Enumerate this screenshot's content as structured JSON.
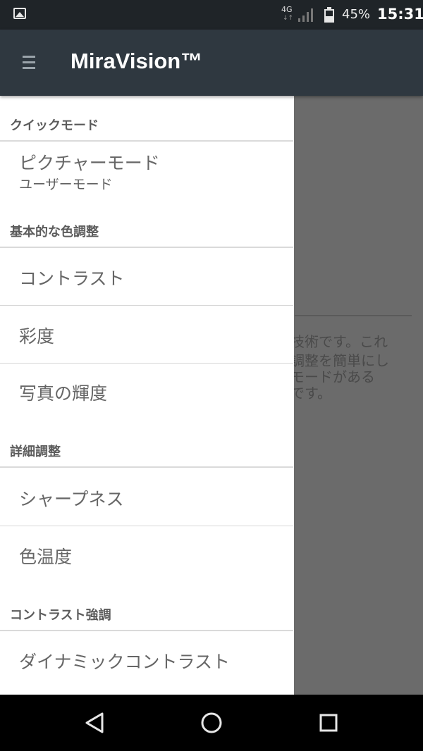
{
  "status_bar": {
    "network": "4G",
    "battery": "45%",
    "time": "15:31"
  },
  "toolbar": {
    "title": "MiraVision™"
  },
  "background_text": {
    "lines": [
      "技術です。これ",
      "調整を簡単にし",
      "モードがある",
      "です。"
    ]
  },
  "drawer": {
    "sections": [
      {
        "header": "クイックモード",
        "items": [
          {
            "label": "ピクチャーモード",
            "sub": "ユーザーモード"
          }
        ]
      },
      {
        "header": "基本的な色調整",
        "items": [
          {
            "label": "コントラスト"
          },
          {
            "label": "彩度"
          },
          {
            "label": "写真の輝度"
          }
        ]
      },
      {
        "header": "詳細調整",
        "items": [
          {
            "label": "シャープネス"
          },
          {
            "label": "色温度"
          }
        ]
      },
      {
        "header": "コントラスト強調",
        "items": [
          {
            "label": "ダイナミックコントラスト"
          }
        ]
      }
    ]
  },
  "nav_bar": {
    "back_icon": "back-triangle-icon",
    "home_icon": "home-circle-icon",
    "recents_icon": "recents-square-icon"
  },
  "colors": {
    "status_bar_bg": "#1f2428",
    "toolbar_bg": "#2f3840",
    "drawer_bg": "#ffffff",
    "scrim_bg": "#6b6b6b",
    "nav_bar_bg": "#000000"
  }
}
